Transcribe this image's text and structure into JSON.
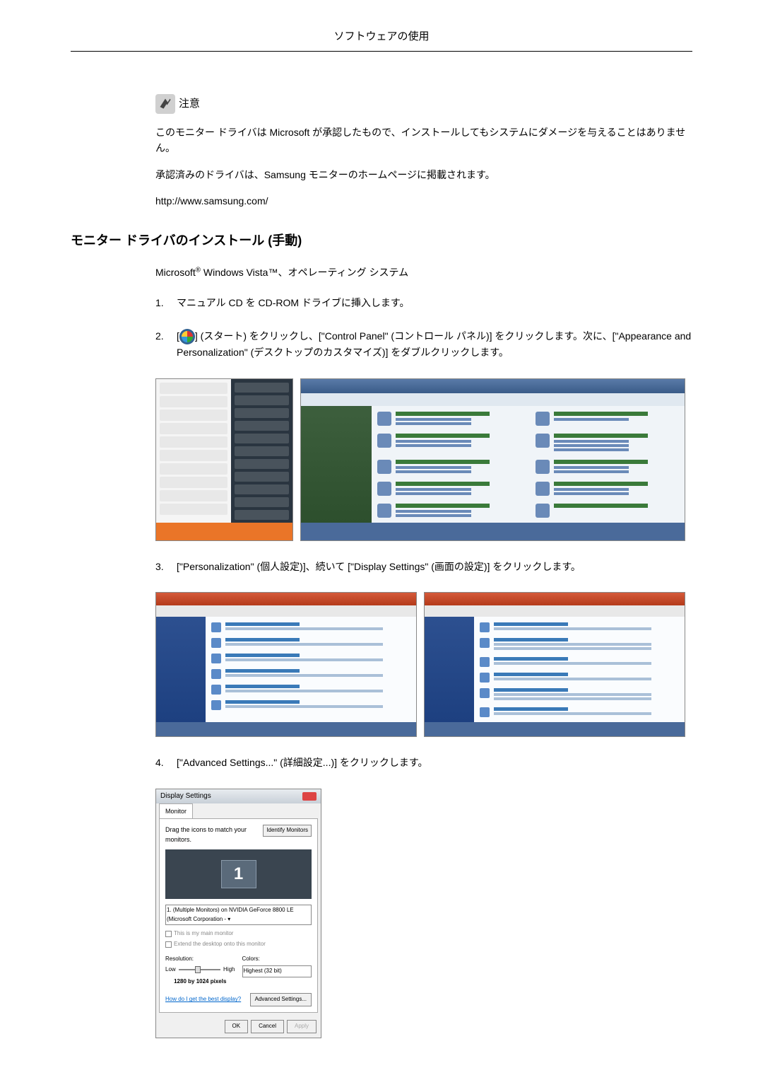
{
  "page_header": "ソフトウェアの使用",
  "notice": {
    "label": "注意",
    "body1": "このモニター ドライバは Microsoft が承認したもので、インストールしてもシステムにダメージを与えることはありません。",
    "body2": "承認済みのドライバは、Samsung モニターのホームページに掲載されます。",
    "url": "http://www.samsung.com/"
  },
  "install_heading": "モニター ドライバのインストール (手動)",
  "install_subheading_prefix": "Microsoft",
  "install_subheading_suffix": " Windows Vista™、オペレーティング システム",
  "steps": {
    "s1": "マニュアル CD を CD-ROM ドライブに挿入します。",
    "s2_a": "[",
    "s2_b": "] (スタート) をクリックし、[\"Control Panel\" (コントロール パネル)] をクリックします。次に、[\"Appearance and Personalization\" (デスクトップのカスタマイズ)] をダブルクリックします。",
    "s3": "[\"Personalization\" (個人設定)]、続いて [\"Display Settings\" (画面の設定)] をクリックします。",
    "s4": "[\"Advanced Settings...\" (詳細設定...)] をクリックします。"
  },
  "display_settings": {
    "title": "Display Settings",
    "tab": "Monitor",
    "drag_text": "Drag the icons to match your monitors.",
    "identify": "Identify Monitors",
    "monitor_number": "1",
    "select_text": "1. (Multiple Monitors) on NVIDIA GeForce 8800 LE (Microsoft Corporation - ▾",
    "cb1": "This is my main monitor",
    "cb2": "Extend the desktop onto this monitor",
    "resolution_label": "Resolution:",
    "low": "Low",
    "high": "High",
    "resolution_value": "1280 by 1024 pixels",
    "colors_label": "Colors:",
    "colors_value": "Highest (32 bit)",
    "help_link": "How do I get the best display?",
    "advanced_btn": "Advanced Settings...",
    "ok": "OK",
    "cancel": "Cancel",
    "apply": "Apply"
  }
}
